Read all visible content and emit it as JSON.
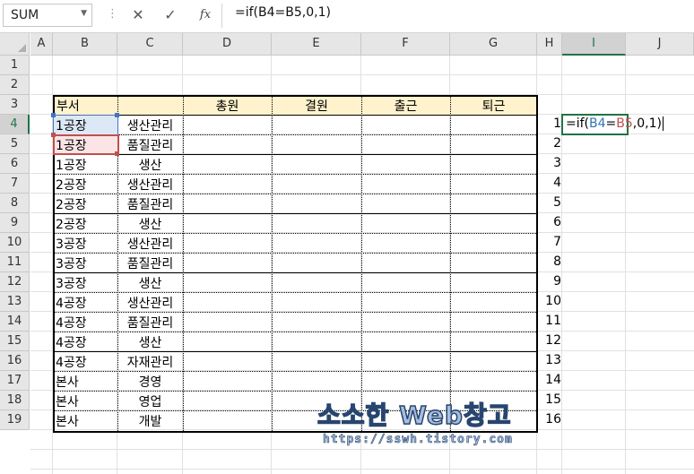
{
  "name_box": {
    "value": "SUM"
  },
  "formula_bar": {
    "cancel_glyph": "✕",
    "enter_glyph": "✓",
    "fx_label": "fx",
    "formula": "=if(B4=B5,0,1)"
  },
  "columns": [
    "A",
    "B",
    "C",
    "D",
    "E",
    "F",
    "G",
    "H",
    "I",
    "J"
  ],
  "selected_column": "I",
  "rows": [
    1,
    2,
    3,
    4,
    5,
    6,
    7,
    8,
    9,
    10,
    11,
    12,
    13,
    14,
    15,
    16,
    17,
    18,
    19
  ],
  "selected_row": 4,
  "table": {
    "header": {
      "b": "부서",
      "d": "총원",
      "e": "결원",
      "f": "출근",
      "g": "퇴근"
    },
    "data": [
      {
        "plant": "1공장",
        "dept": "생산관리"
      },
      {
        "plant": "1공장",
        "dept": "품질관리"
      },
      {
        "plant": "1공장",
        "dept": "생산"
      },
      {
        "plant": "2공장",
        "dept": "생산관리"
      },
      {
        "plant": "2공장",
        "dept": "품질관리"
      },
      {
        "plant": "2공장",
        "dept": "생산"
      },
      {
        "plant": "3공장",
        "dept": "생산관리"
      },
      {
        "plant": "3공장",
        "dept": "품질관리"
      },
      {
        "plant": "3공장",
        "dept": "생산"
      },
      {
        "plant": "4공장",
        "dept": "생산관리"
      },
      {
        "plant": "4공장",
        "dept": "품질관리"
      },
      {
        "plant": "4공장",
        "dept": "생산"
      },
      {
        "plant": "4공장",
        "dept": "자재관리"
      },
      {
        "plant": "본사",
        "dept": "경영"
      },
      {
        "plant": "본사",
        "dept": "영업"
      },
      {
        "plant": "본사",
        "dept": "개발"
      }
    ]
  },
  "h_numbers": [
    "1",
    "2",
    "3",
    "4",
    "5",
    "6",
    "7",
    "8",
    "9",
    "10",
    "11",
    "12",
    "13",
    "14",
    "15",
    "16"
  ],
  "edit": {
    "p1": "=if(",
    "r1": "B4",
    "eq": "=",
    "r2": "B5",
    "tail": ",0,1)"
  },
  "colors": {
    "ref1": "#2e75b6",
    "ref2": "#c0504d",
    "header_fill": "#fff2cc",
    "accent": "#217346"
  },
  "watermark": {
    "main": "소소한 Web창고",
    "sub": "https://sswh.tistory.com"
  }
}
